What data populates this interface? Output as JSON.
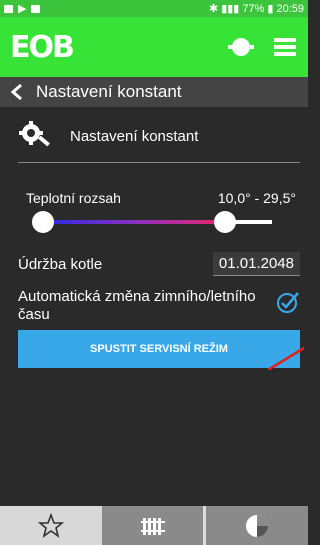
{
  "status": {
    "battery": "77%",
    "time": "20:59"
  },
  "header": {
    "logo": "EOB"
  },
  "titlebar": {
    "title": "Nastavení konstant"
  },
  "section": {
    "title": "Nastavení konstant"
  },
  "temperature": {
    "label": "Teplotní rozsah",
    "value": "10,0° -  29,5°",
    "range_low": 10.0,
    "range_high": 29.5
  },
  "maintenance": {
    "label": "Údržba kotle",
    "date": "01.01.2048"
  },
  "dst": {
    "label": "Automatická změna zimního/letního času",
    "checked": true
  },
  "service_button": {
    "label": "SPUSTIT SERVISNÍ REŽIM"
  },
  "colors": {
    "brand": "#37e337",
    "accent": "#38a8e8",
    "background": "#2a2a2a"
  },
  "nav": [
    {
      "icon": "star-icon"
    },
    {
      "icon": "radiator-icon"
    },
    {
      "icon": "pie-chart-icon"
    }
  ]
}
